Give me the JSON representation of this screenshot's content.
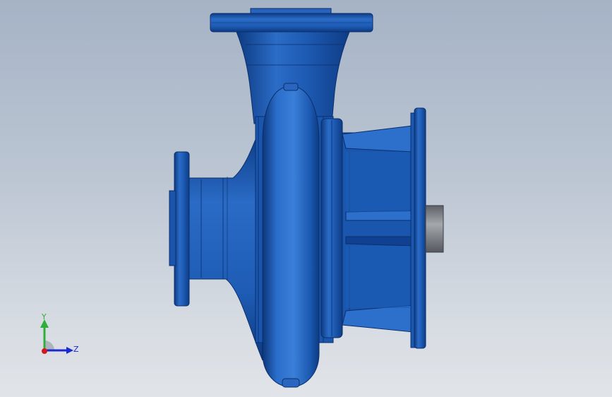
{
  "viewport": {
    "background_top": "#a5b3c6",
    "background_bottom": "#e1e4e8",
    "part_color": "#1f5fb8",
    "part_shadow": "#0e3c85",
    "part_highlight": "#5a9ae8",
    "shaft_color": "#8a8e94"
  },
  "triad": {
    "y_label": "Y",
    "z_label": "Z",
    "y_color": "#2fae3a",
    "z_color": "#1a2ad0",
    "x_color": "#d01a1a"
  }
}
